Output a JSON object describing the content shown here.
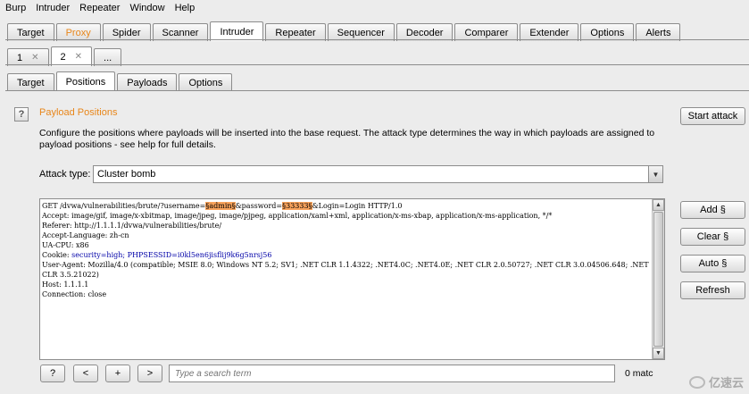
{
  "menu": [
    "Burp",
    "Intruder",
    "Repeater",
    "Window",
    "Help"
  ],
  "main_tabs": [
    "Target",
    "Proxy",
    "Spider",
    "Scanner",
    "Intruder",
    "Repeater",
    "Sequencer",
    "Decoder",
    "Comparer",
    "Extender",
    "Options",
    "Alerts"
  ],
  "attack_tabs": {
    "t1": "1",
    "t2": "2",
    "more": "..."
  },
  "sub_tabs": [
    "Target",
    "Positions",
    "Payloads",
    "Options"
  ],
  "section": {
    "help": "?",
    "title": "Payload Positions",
    "description": "Configure the positions where payloads will be inserted into the base request. The attack type determines the way in which payloads are assigned to payload positions - see help for full details."
  },
  "start_attack": "Start attack",
  "attack_type": {
    "label": "Attack type:",
    "value": "Cluster bomb"
  },
  "request": {
    "l1_pre": "GET /dvwa/vulnerabilities/brute/?username=",
    "l1_p1": "§admin§",
    "l1_mid": "&password=",
    "l1_p2": "§33333§",
    "l1_post": "&Login=Login HTTP/1.0",
    "l2": "Accept: image/gif, image/x-xbitmap, image/jpeg, image/pjpeg, application/xaml+xml, application/x-ms-xbap, application/x-ms-application, */*",
    "l3": "Referer: http://1.1.1.1/dvwa/vulnerabilities/brute/",
    "l4": "Accept-Language: zh-cn",
    "l5": "UA-CPU: x86",
    "l6_pre": "Cookie: ",
    "l6_security": "security=high; PHPSESSID=i0kl5en6jisflij9k6g5nrsj56",
    "l7": "User-Agent: Mozilla/4.0 (compatible; MSIE 8.0; Windows NT 5.2; SV1; .NET CLR 1.1.4322; .NET4.0C; .NET4.0E; .NET CLR 2.0.50727; .NET CLR 3.0.04506.648; .NET CLR 3.5.21022)",
    "l8": "Host: 1.1.1.1",
    "l9": "Connection: close"
  },
  "side_buttons": {
    "add": "Add §",
    "clear": "Clear §",
    "auto": "Auto §",
    "refresh": "Refresh"
  },
  "search": {
    "help": "?",
    "prev": "<",
    "add": "+",
    "next": ">",
    "placeholder": "Type a search term",
    "matches": "0 matc"
  },
  "watermark": "亿速云"
}
